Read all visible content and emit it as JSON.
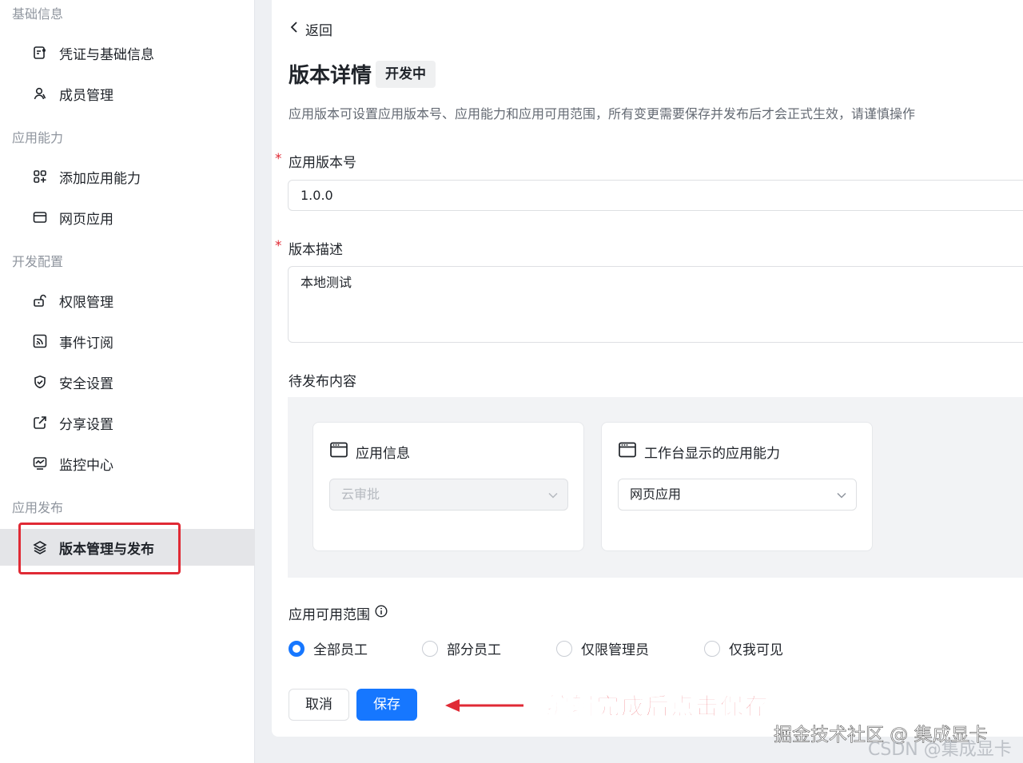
{
  "sidebar": {
    "groups": [
      {
        "title": "基础信息"
      },
      {
        "title": "应用能力"
      },
      {
        "title": "开发配置"
      },
      {
        "title": "应用发布"
      }
    ],
    "items": [
      {
        "label": "凭证与基础信息",
        "icon": "credential-icon"
      },
      {
        "label": "成员管理",
        "icon": "member-icon"
      },
      {
        "label": "添加应用能力",
        "icon": "add-capability-icon"
      },
      {
        "label": "网页应用",
        "icon": "web-app-icon"
      },
      {
        "label": "权限管理",
        "icon": "lock-icon"
      },
      {
        "label": "事件订阅",
        "icon": "rss-icon"
      },
      {
        "label": "安全设置",
        "icon": "shield-icon"
      },
      {
        "label": "分享设置",
        "icon": "share-icon"
      },
      {
        "label": "监控中心",
        "icon": "monitor-icon"
      },
      {
        "label": "版本管理与发布",
        "icon": "layers-icon",
        "active": true
      }
    ]
  },
  "main": {
    "back_label": "返回",
    "title": "版本详情",
    "status_tag": "开发中",
    "description": "应用版本可设置应用版本号、应用能力和应用可用范围，所有变更需要保存并发布后才会正式生效，请谨慎操作",
    "required_mark": "*",
    "version_label": "应用版本号",
    "version_value": "1.0.0",
    "desc_label": "版本描述",
    "desc_value": "本地测试",
    "pending_label": "待发布内容",
    "cards": [
      {
        "title": "应用信息",
        "select_value": "云审批",
        "disabled": true
      },
      {
        "title": "工作台显示的应用能力",
        "select_value": "网页应用",
        "disabled": false
      }
    ],
    "scope_label": "应用可用范围",
    "scope_options": [
      {
        "label": "全部员工",
        "checked": true
      },
      {
        "label": "部分员工",
        "checked": false
      },
      {
        "label": "仅限管理员",
        "checked": false
      },
      {
        "label": "仅我可见",
        "checked": false
      }
    ],
    "cancel_label": "取消",
    "save_label": "保存"
  },
  "annotation": {
    "text": "编辑完成后点击保存",
    "color": "#e83a45"
  },
  "watermark": {
    "line1": "掘金技术社区 @ 集成显卡",
    "line2": "CSDN @集成显卡"
  },
  "colors": {
    "accent": "#1677ff",
    "highlight": "#e02a35"
  }
}
